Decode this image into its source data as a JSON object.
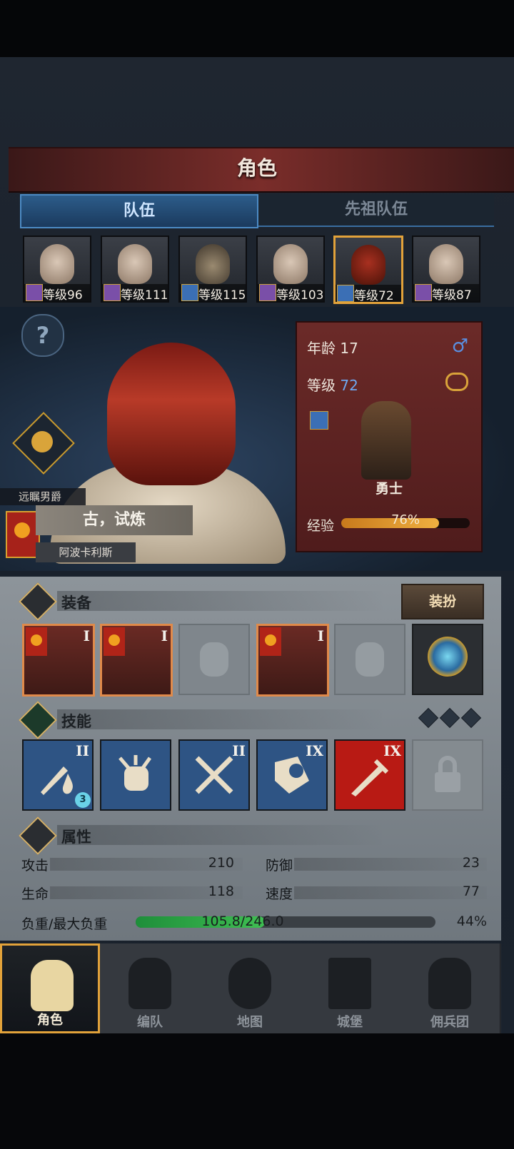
{
  "header": {
    "title": "角色"
  },
  "tabs": [
    {
      "label": "队伍",
      "active": true
    },
    {
      "label": "先祖队伍",
      "active": false
    }
  ],
  "party": [
    {
      "level": "等级96",
      "class_icon": "staff-icon"
    },
    {
      "level": "等级111",
      "class_icon": "staff-icon"
    },
    {
      "level": "等级115",
      "class_icon": "sword-icon"
    },
    {
      "level": "等级103",
      "class_icon": "staff-icon"
    },
    {
      "level": "等级72",
      "class_icon": "sword-icon",
      "selected": true
    },
    {
      "level": "等级87",
      "class_icon": "staff-icon"
    }
  ],
  "hero": {
    "rank_title": "远瞩男爵",
    "name": "古，试炼",
    "origin": "阿波卡利斯"
  },
  "card": {
    "age_label": "年龄",
    "age_value": "17",
    "level_label": "等级",
    "level_value": "72",
    "class_name": "勇士",
    "xp_label": "经验",
    "xp_text": "76%",
    "xp_fraction": 0.76
  },
  "equipment": {
    "label": "装备",
    "dress_button": "装扮",
    "slots": [
      {
        "type": "item",
        "tier": "I"
      },
      {
        "type": "item",
        "tier": "I"
      },
      {
        "type": "empty",
        "icon": "helmet-icon"
      },
      {
        "type": "item",
        "tier": "I"
      },
      {
        "type": "empty",
        "icon": "boots-icon"
      },
      {
        "type": "ring"
      }
    ]
  },
  "skills": {
    "label": "技能",
    "slots": [
      {
        "tier": "II",
        "color": "#2e5484",
        "icon": "sword-drop-icon",
        "badge": "3"
      },
      {
        "tier": "",
        "color": "#2e5484",
        "icon": "fist-icon"
      },
      {
        "tier": "II",
        "color": "#2e5484",
        "icon": "crossed-swords-icon"
      },
      {
        "tier": "IX",
        "color": "#2e5484",
        "icon": "shield-burst-icon"
      },
      {
        "tier": "IX",
        "color": "#b81a14",
        "icon": "sword-icon"
      },
      {
        "tier": "",
        "icon": "lock-icon",
        "locked": true
      }
    ]
  },
  "attributes": {
    "label": "属性",
    "attack_label": "攻击",
    "attack_value": "210",
    "defense_label": "防御",
    "defense_value": "23",
    "hp_label": "生命",
    "hp_value": "118",
    "speed_label": "速度",
    "speed_value": "77",
    "load_label": "负重/最大负重",
    "load_text": "105.8/246.0",
    "load_percent": "44%",
    "load_fraction": 0.43
  },
  "nav": [
    {
      "label": "角色",
      "selected": true
    },
    {
      "label": "编队"
    },
    {
      "label": "地图"
    },
    {
      "label": "城堡"
    },
    {
      "label": "佣兵团"
    }
  ]
}
